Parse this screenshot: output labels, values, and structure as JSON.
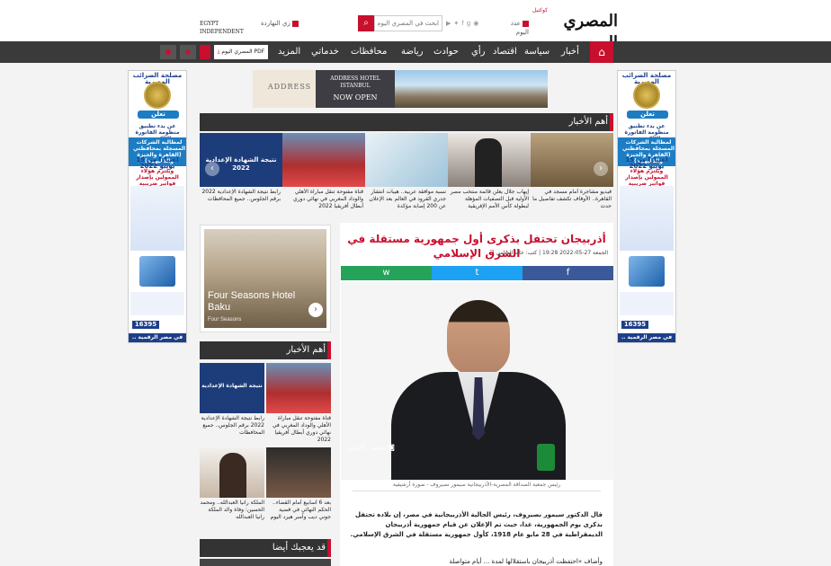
{
  "header": {
    "logo_text": "المصري اليوم",
    "logo_small": "كوكتيل",
    "search_placeholder": "ابحث في المصري اليوم",
    "today_issue": "عدد اليوم",
    "egypt_independent": "EGYPT INDEPENDENT",
    "visit_label": "زي النهاردة"
  },
  "nav": {
    "items": [
      "أخبار",
      "سياسة",
      "اقتصاد",
      "رأي",
      "حوادث",
      "رياضة",
      "محافظات",
      "خدماتي",
      "المزيد"
    ],
    "pdf_label": "المصري اليوم PDF"
  },
  "ad_banner": {
    "brand": "ADDRESS",
    "sub": "ISTANBUL",
    "headline": "ADDRESS HOTEL ISTANBUL",
    "cta": "NOW OPEN"
  },
  "side_ad": {
    "title": "مصلحة الضرائب المصرية",
    "announce": "تعلن",
    "line1": "عن بدء تطبيق منظومة الفاتورة الالكترونية",
    "line2": "لمطالبة الشركات المسجلة بمحافظتي (القاهرة والجيزة والقليوبية)",
    "date": "اعتبارا من 15 يونيو 2022",
    "line3": "ويلتزم هؤلاء الممولين بإصدار فواتير ضريبية إلكترونية",
    "phone": "16395",
    "footer": "في مصر الرقمية .. فواتيرنا الكترونية"
  },
  "top_news": {
    "header": "أهم الأخبار",
    "items": [
      {
        "caption": "فيديو مشاجرة أمام مسجد في القاهرة.. الأوقاف تكشف تفاصيل ما حدث",
        "overlay": ""
      },
      {
        "caption": "إيهاب جلال يعلن قائمة منتخب مصر الأولية قبل التصفيات المؤهلة لبطولة كأس الأمم الإفريقية",
        "overlay": ""
      },
      {
        "caption": "نسبة موافقة عربية.. هيبات انتشار جدري القرود في العالم بعد الإعلان عن 200 إصابة مؤكدة",
        "overlay": ""
      },
      {
        "caption": "قناة مفتوحة تنقل مباراة الأهلي والوداد المغربي في نهائي دوري أبطال أفريقيا 2022",
        "overlay": ""
      },
      {
        "caption": "رابط نتيجة الشهادة الإعدادية 2022 برقم الجلوس.. جميع المحافظات",
        "overlay": "نتيجة الشهادة الإعدادية 2022"
      }
    ]
  },
  "article": {
    "title": "أذربيجان تحتفل بذكرى أول جمهورية مستقلة في الشرق الإسلامي",
    "meta": "الجمعة 27-05-2022 19:28 | كتب: خالد الشامي |",
    "photo_credit": "تصوير : آخرون",
    "photo_caption": "رئيس جمعية الصداقة المصرية-الأذربيجانية سيمور نصيروف - صورة أرشيفية",
    "body1": "قال الدكتور سيمور نصيروف، رئيس الجالية الأذربيجانية في مصر، إن بلاده تحتفل بذكرى يوم الجمهورية، غدا، حيث تم الإعلان عن قيام جمهورية أذربيجان الديمقراطية في 28 مايو عام 1918، كأول جمهورية مستقلة في الشرق الإسلامي.",
    "body2": "وأضاف «احتفظت أذربيجان باستقلالها لمدة ... أيام متواصلة"
  },
  "share": {
    "facebook": "f",
    "twitter": "t",
    "whatsapp": "w"
  },
  "hotel_ad": {
    "title": "Four Seasons Hotel Baku",
    "sub": "Four Seasons"
  },
  "news_section": {
    "header": "أهم الأخبار",
    "items": [
      {
        "caption": "قناة مفتوحة تنقل مباراة الأهلي والوداد المغربي في نهائي دوري أبطال أفريقيا 2022"
      },
      {
        "caption": "رابط نتيجة الشهادة الإعدادية 2022 برقم الجلوس.. جميع المحافظات",
        "overlay": "نتيجة الشهادة الإعدادية"
      },
      {
        "caption": "بعد 6 أسابيع أمام القضاء.. الحكم النهائي في قضية جوني ديب وآمبر هيرد اليوم"
      },
      {
        "caption": "الملكة رانيا العبدالله.. ومحمد الحسين: وفاة والد الملكة رانيا العبدالله"
      }
    ]
  },
  "you_may_like": {
    "header": "قد يعجبك أيضا"
  },
  "colors": {
    "brand_red": "#c8102e",
    "nav_bg": "#3a3a3a",
    "facebook": "#3b5998",
    "twitter": "#1da1f2",
    "whatsapp": "#25a35a"
  }
}
